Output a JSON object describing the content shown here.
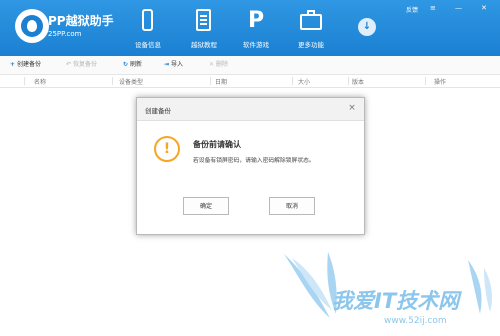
{
  "app": {
    "name": "PP越狱助手",
    "domain": "25PP.com"
  },
  "nav": [
    {
      "label": "设备信息",
      "icon": "phone-icon"
    },
    {
      "label": "越狱教程",
      "icon": "book-icon"
    },
    {
      "label": "软件游戏",
      "icon": "pp-logo-icon"
    },
    {
      "label": "更多功能",
      "icon": "toolbox-icon"
    }
  ],
  "window": {
    "feedback": "反馈",
    "menu_glyph": "≡",
    "minimize_glyph": "—",
    "close_glyph": "✕",
    "download_glyph": "↓"
  },
  "toolbar": {
    "create_backup": "创建备份",
    "restore_backup": "恢复备份",
    "refresh": "刷新",
    "import": "导入",
    "delete": "删除",
    "create_glyph": "+",
    "restore_glyph": "↶",
    "refresh_glyph": "↻",
    "import_glyph": "⇥",
    "delete_glyph": "✕"
  },
  "columns": [
    "名称",
    "设备类型",
    "日期",
    "大小",
    "版本",
    "操作"
  ],
  "dialog": {
    "title": "创建备份",
    "close_glyph": "×",
    "warn_glyph": "!",
    "heading": "备份前请确认",
    "message": "若设备有锁屏密码，请输入密码解除锁屏状态。",
    "confirm": "确定",
    "cancel": "取消"
  },
  "watermark": {
    "text": "我爱IT技术网",
    "url": "www.52ij.com"
  },
  "colors": {
    "brand_blue": "#1b80d2",
    "warning_orange": "#f5a623",
    "watermark_blue": "#8cc6ec"
  }
}
